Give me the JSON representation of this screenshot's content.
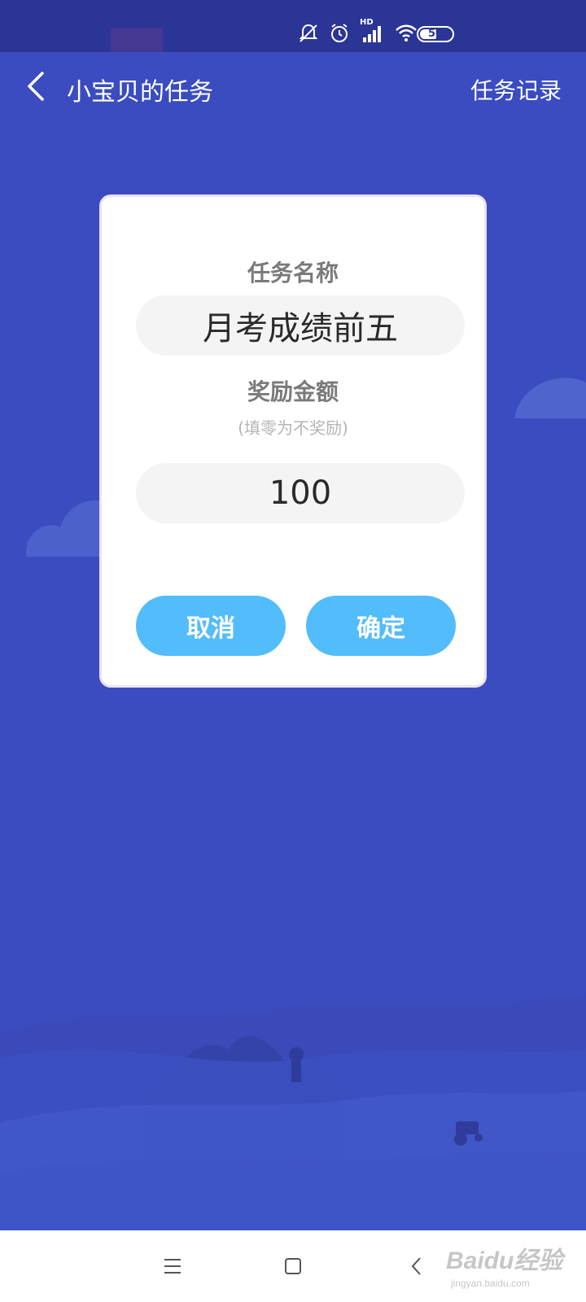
{
  "status_bar": {
    "battery_level": "50",
    "network_label": "HD",
    "icons": [
      "notification-off-icon",
      "alarm-icon",
      "signal-icon",
      "wifi-icon",
      "battery-icon"
    ]
  },
  "app_bar": {
    "title": "小宝贝的任务",
    "right_link": "任务记录"
  },
  "dialog": {
    "task_name_label": "任务名称",
    "task_name_value": "月考成绩前五",
    "reward_label": "奖励金额",
    "reward_hint": "(填零为不奖励)",
    "reward_value": "100",
    "cancel_label": "取消",
    "confirm_label": "确定"
  },
  "nav_bar": {
    "icons": [
      "menu-icon",
      "home-icon",
      "back-icon"
    ]
  },
  "watermark": {
    "logo_text": "Baidu经验",
    "sub_text": "jingyan.baidu.com"
  },
  "colors": {
    "background": "#3a4cc0",
    "status_bar": "#2b3595",
    "button": "#53bcfb",
    "field": "#f4f4f4"
  }
}
